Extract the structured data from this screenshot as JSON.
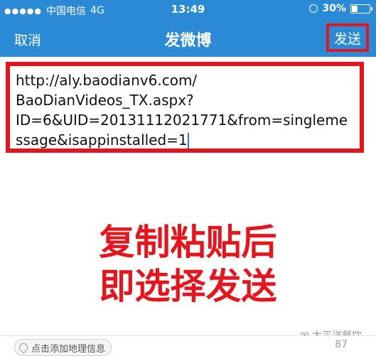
{
  "status": {
    "carrier": "中国电信",
    "network": "4G",
    "time": "13:49",
    "battery": "30%",
    "battery_level": 0.3
  },
  "nav": {
    "cancel": "取消",
    "title": "发微博",
    "send": "发送"
  },
  "compose": {
    "text": "http://aly.baodianv6.com/\nBaoDianVideos_TX.aspx?\nID=6&UID=20131112021771&from=singlemessage&isappinstalled=1"
  },
  "overlay": {
    "line1": "复制粘贴后",
    "line2": "即选择发送"
  },
  "bottom": {
    "location": "点击添加地理信息",
    "count": "87"
  },
  "watermark": "太平洋餐饮",
  "colors": {
    "brand_blue": "#2a8ad6",
    "highlight_red": "#e8141c"
  }
}
